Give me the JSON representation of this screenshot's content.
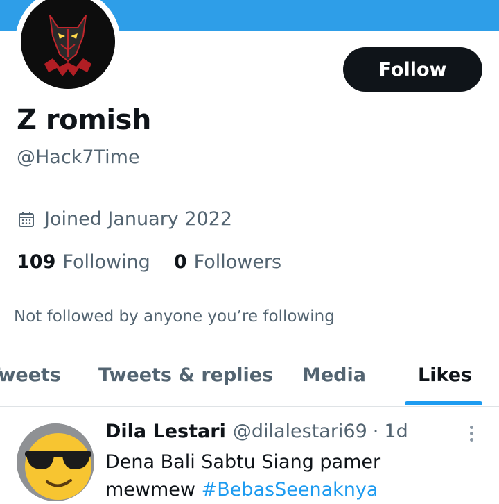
{
  "profile": {
    "display_name": "Z romish",
    "handle": "@Hack7Time",
    "joined": "Joined January 2022",
    "following_count": "109",
    "following_label": "Following",
    "followers_count": "0",
    "followers_label": "Followers",
    "not_followed_text": "Not followed by anyone you’re following",
    "follow_button_label": "Follow"
  },
  "tabs": [
    {
      "label": "Tweets"
    },
    {
      "label": "Tweets & replies"
    },
    {
      "label": "Media"
    },
    {
      "label": "Likes",
      "active": true
    }
  ],
  "tweet": {
    "author_name": "Dila Lestari",
    "author_handle": "@dilalestari69",
    "separator": "·",
    "time": "1d",
    "text_line1": "Dena Bali Sabtu Siang pamer",
    "text_line2_prefix": "mewmew",
    "hashtag": "#BebasSeenaknya"
  },
  "icons": {
    "calendar": "calendar-icon",
    "more": "more-vertical-icon"
  },
  "colors": {
    "banner": "#2e9ee8",
    "accent": "#1d9bf0",
    "text_primary": "#0f1419",
    "text_secondary": "#536471",
    "button_bg": "#0f1419"
  }
}
